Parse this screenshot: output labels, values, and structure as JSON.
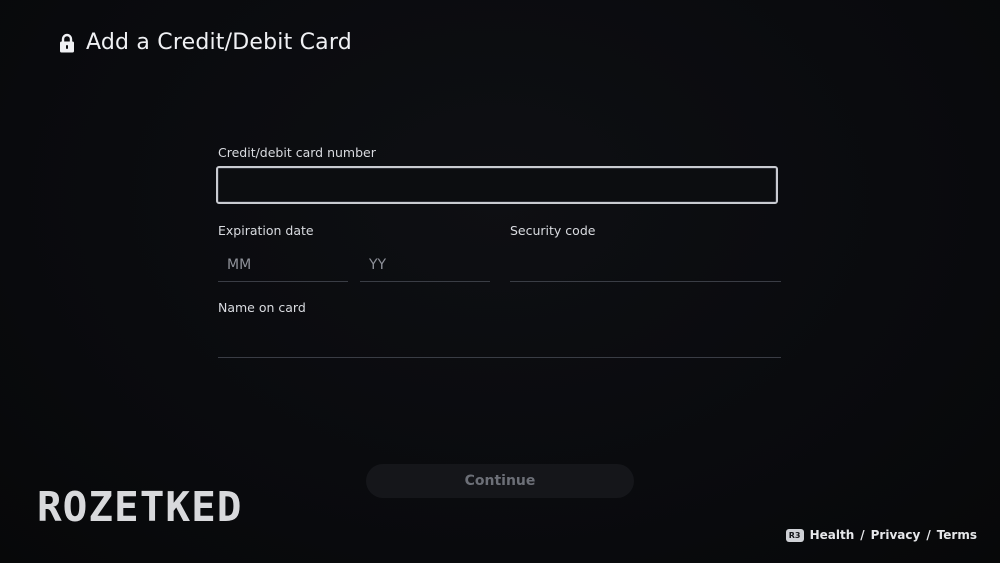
{
  "header": {
    "title": "Add a Credit/Debit Card",
    "icon": "lock-icon"
  },
  "form": {
    "card_number": {
      "label": "Credit/debit card number",
      "value": ""
    },
    "expiration": {
      "label": "Expiration date",
      "month_placeholder": "MM",
      "year_placeholder": "YY"
    },
    "security_code": {
      "label": "Security code",
      "value": ""
    },
    "name_on_card": {
      "label": "Name on card",
      "value": ""
    }
  },
  "actions": {
    "continue_label": "Continue"
  },
  "watermark": {
    "text": "ROZETKED"
  },
  "footer": {
    "button_glyph": "R3",
    "health": "Health",
    "privacy": "Privacy",
    "terms": "Terms",
    "separator": "/"
  },
  "colors": {
    "background": "#0a0b0e",
    "text": "#e9eaee",
    "focus_border": "#c9cbd1",
    "disabled_button": "#15161a"
  }
}
